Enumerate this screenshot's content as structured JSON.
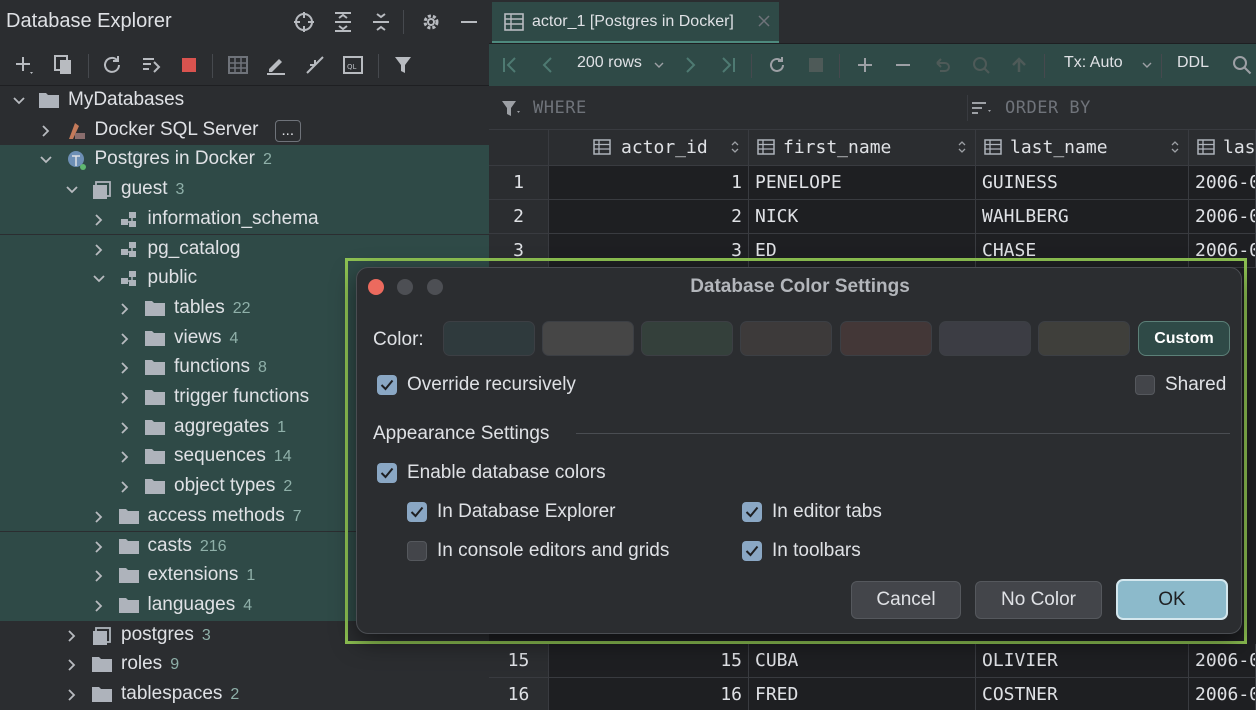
{
  "explorer": {
    "title": "Database Explorer",
    "tree": [
      {
        "label": "MyDatabases",
        "count": ""
      },
      {
        "label": "Docker SQL Server",
        "count": "",
        "badge": "..."
      },
      {
        "label": "Postgres in Docker",
        "count": "2"
      },
      {
        "label": "guest",
        "count": "3"
      },
      {
        "label": "information_schema",
        "count": ""
      },
      {
        "label": "pg_catalog",
        "count": ""
      },
      {
        "label": "public",
        "count": ""
      },
      {
        "label": "tables",
        "count": "22"
      },
      {
        "label": "views",
        "count": "4"
      },
      {
        "label": "functions",
        "count": "8"
      },
      {
        "label": "trigger functions",
        "count": ""
      },
      {
        "label": "aggregates",
        "count": "1"
      },
      {
        "label": "sequences",
        "count": "14"
      },
      {
        "label": "object types",
        "count": "2"
      },
      {
        "label": "access methods",
        "count": "7"
      },
      {
        "label": "casts",
        "count": "216"
      },
      {
        "label": "extensions",
        "count": "1"
      },
      {
        "label": "languages",
        "count": "4"
      },
      {
        "label": "postgres",
        "count": "3"
      },
      {
        "label": "roles",
        "count": "9"
      },
      {
        "label": "tablespaces",
        "count": "2"
      }
    ]
  },
  "editor": {
    "tab_label": "actor_1 [Postgres in Docker]",
    "toolbar": {
      "rows": "200 rows",
      "tx": "Tx: Auto",
      "ddl": "DDL"
    },
    "where_label": "WHERE",
    "orderby_label": "ORDER BY",
    "columns": [
      "actor_id",
      "first_name",
      "last_name",
      "las"
    ],
    "rows_top": [
      {
        "n": "1",
        "id": "1",
        "first": "PENELOPE",
        "last": "GUINESS",
        "date": "2006-0"
      },
      {
        "n": "2",
        "id": "2",
        "first": "NICK",
        "last": "WAHLBERG",
        "date": "2006-0"
      },
      {
        "n": "3",
        "id": "3",
        "first": "ED",
        "last": "CHASE",
        "date": "2006-0"
      }
    ],
    "rows_bottom": [
      {
        "n": "15",
        "id": "15",
        "first": "CUBA",
        "last": "OLIVIER",
        "date": "2006-0"
      },
      {
        "n": "16",
        "id": "16",
        "first": "FRED",
        "last": "COSTNER",
        "date": "2006-0"
      }
    ]
  },
  "dialog": {
    "title": "Database Color Settings",
    "color_label": "Color:",
    "custom_label": "Custom",
    "swatches": [
      "#2f3a3d",
      "#464646",
      "#34403b",
      "#3d3a3a",
      "#433737",
      "#3c3d44",
      "#3f3f3b"
    ],
    "override_label": "Override recursively",
    "override_checked": true,
    "shared_label": "Shared",
    "shared_checked": false,
    "appearance_label": "Appearance Settings",
    "enable_colors_label": "Enable database colors",
    "in_explorer_label": "In Database Explorer",
    "in_editor_tabs_label": "In editor tabs",
    "in_console_label": "In console editors and grids",
    "in_toolbars_label": "In toolbars",
    "cancel_label": "Cancel",
    "nocolor_label": "No Color",
    "ok_label": "OK"
  },
  "colors": {
    "accent_green": "#8dc152",
    "db_tint": "#2f4a47",
    "ok_button": "#8cbacb"
  }
}
